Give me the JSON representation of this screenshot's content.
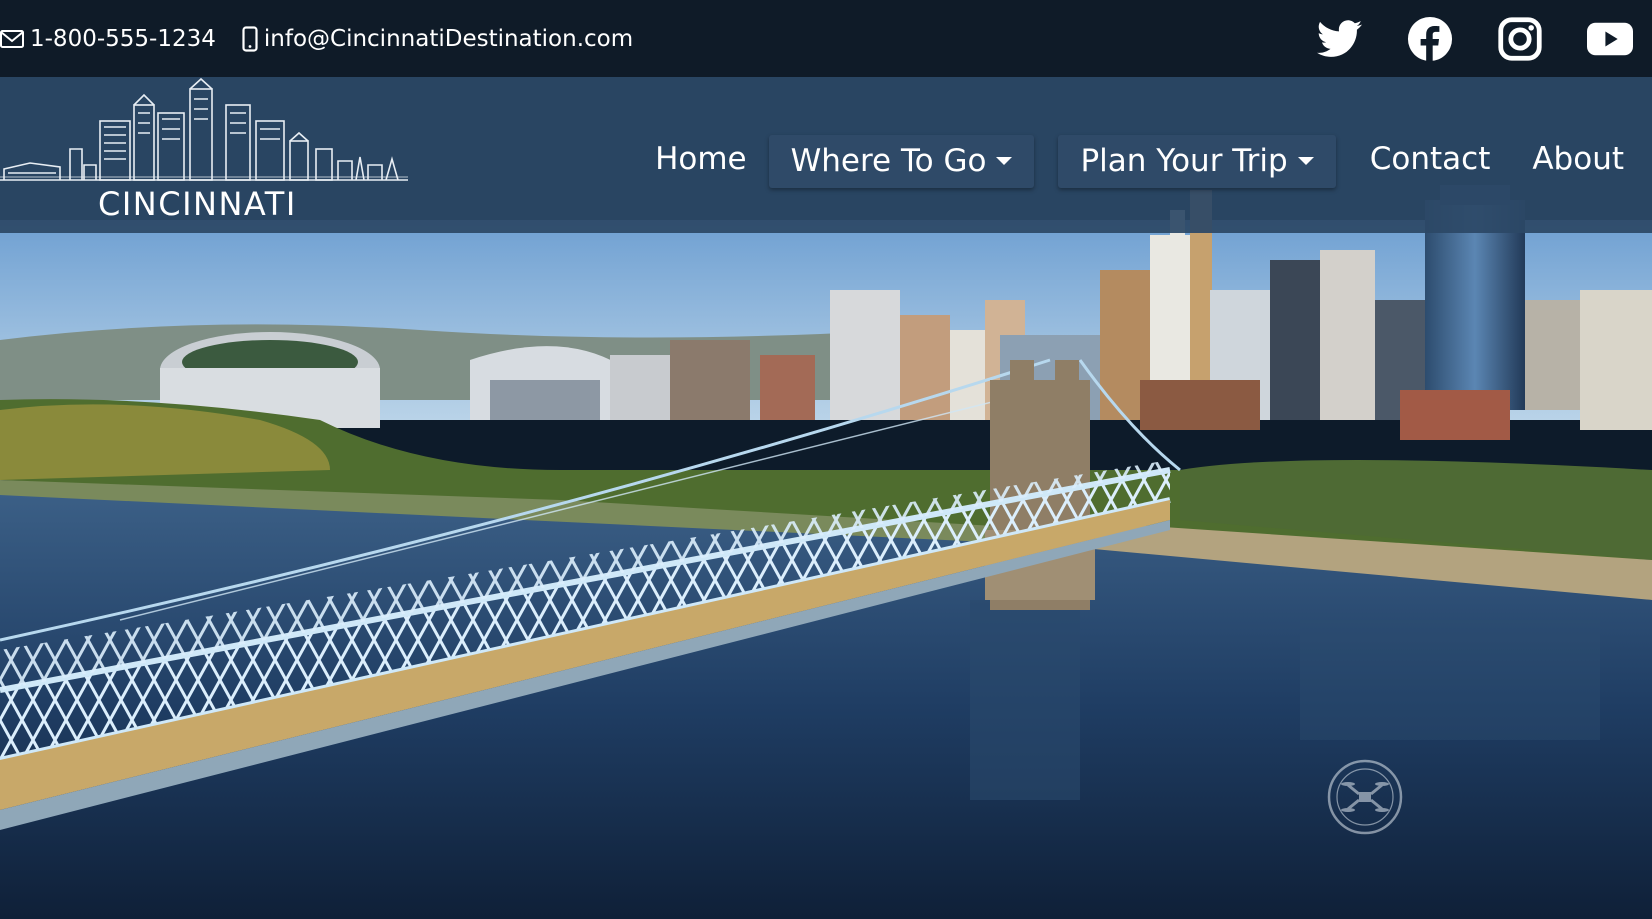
{
  "topbar": {
    "phone": "1-800-555-1234",
    "email": "info@CincinnatiDestination.com",
    "phone_icon": "envelope-icon",
    "email_icon": "mobile-phone-icon",
    "social": [
      {
        "name": "twitter",
        "icon": "twitter-icon"
      },
      {
        "name": "facebook",
        "icon": "facebook-icon"
      },
      {
        "name": "instagram",
        "icon": "instagram-icon"
      },
      {
        "name": "youtube",
        "icon": "youtube-icon"
      }
    ]
  },
  "navbar": {
    "brand": "CINCINNATI",
    "logo_icon": "skyline-logo-icon",
    "items": {
      "home": "Home",
      "where_to_go": "Where To Go",
      "plan_your_trip": "Plan Your Trip",
      "contact": "Contact",
      "about": "About"
    }
  },
  "hero": {
    "image": "aerial view of Cincinnati skyline, Roebling suspension bridge and Ohio River",
    "watermark_icon": "drone-logo-icon"
  },
  "colors": {
    "topbar_bg": "#0f1b28",
    "navbar_bg": "#2c4866",
    "dropdown_bg": "#2f4a68",
    "text": "#ffffff",
    "bridge": "#a8cdea",
    "river": "#1e3a5f"
  }
}
